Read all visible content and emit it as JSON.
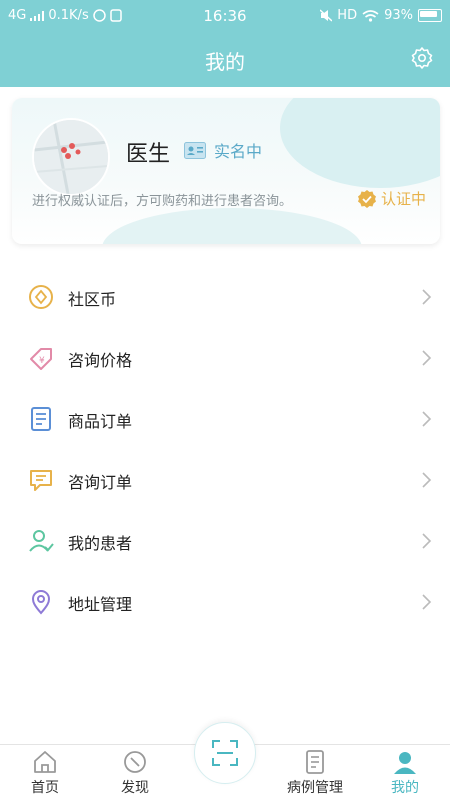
{
  "status_bar": {
    "network": "4G",
    "speed": "0.1K/s",
    "time": "16:36",
    "hd": "HD",
    "battery": "93%"
  },
  "header": {
    "title": "我的",
    "settings_icon": "gear-icon"
  },
  "profile": {
    "name": "医生",
    "verification_label": "实名中",
    "note": "进行权威认证后，方可购药和进行患者咨询。",
    "certification_status": "认证中",
    "colors": {
      "accent": "#7fd0d4",
      "status": "#e7b24a",
      "badge": "#5aa9c8"
    }
  },
  "menu": {
    "items": [
      {
        "label": "社区币",
        "icon": "coin-icon"
      },
      {
        "label": "咨询价格",
        "icon": "price-tag-icon"
      },
      {
        "label": "商品订单",
        "icon": "document-icon"
      },
      {
        "label": "咨询订单",
        "icon": "chat-icon"
      },
      {
        "label": "我的患者",
        "icon": "patient-icon"
      },
      {
        "label": "地址管理",
        "icon": "location-pin-icon"
      }
    ]
  },
  "bottom_nav": {
    "items": [
      {
        "label": "首页",
        "icon": "home-icon"
      },
      {
        "label": "发现",
        "icon": "compass-icon"
      },
      {
        "label": "病例管理",
        "icon": "case-record-icon"
      },
      {
        "label": "我的",
        "icon": "user-icon",
        "active": true
      }
    ],
    "center": "scan-icon"
  }
}
